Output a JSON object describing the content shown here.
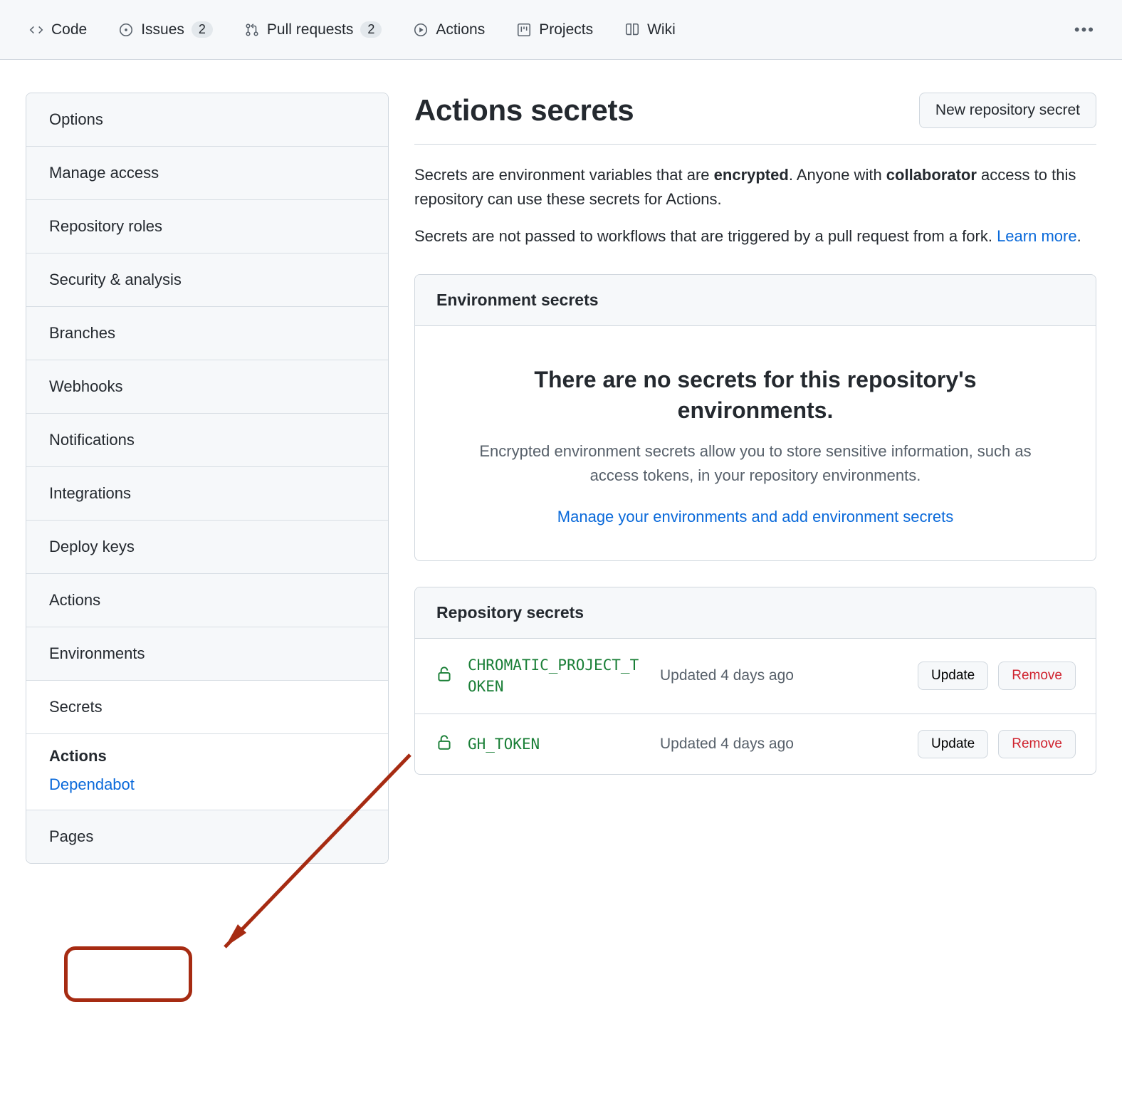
{
  "topnav": {
    "tabs": [
      {
        "label": "Code"
      },
      {
        "label": "Issues",
        "count": "2"
      },
      {
        "label": "Pull requests",
        "count": "2"
      },
      {
        "label": "Actions"
      },
      {
        "label": "Projects"
      },
      {
        "label": "Wiki"
      }
    ]
  },
  "sidebar": {
    "items": [
      "Options",
      "Manage access",
      "Repository roles",
      "Security & analysis",
      "Branches",
      "Webhooks",
      "Notifications",
      "Integrations",
      "Deploy keys",
      "Actions",
      "Environments",
      "Secrets"
    ],
    "sub": {
      "heading": "Actions",
      "link": "Dependabot"
    },
    "pages": "Pages"
  },
  "header": {
    "title": "Actions secrets",
    "new_button": "New repository secret"
  },
  "description": {
    "p1_a": "Secrets are environment variables that are ",
    "p1_b": "encrypted",
    "p1_c": ". Anyone with ",
    "p1_d": "collaborator",
    "p1_e": " access to this repository can use these secrets for Actions.",
    "p2_a": "Secrets are not passed to workflows that are triggered by a pull request from a fork. ",
    "p2_link": "Learn more",
    "p2_b": "."
  },
  "env_panel": {
    "heading": "Environment secrets",
    "blank_title": "There are no secrets for this repository's environments.",
    "blank_desc": "Encrypted environment secrets allow you to store sensitive information, such as access tokens, in your repository environments.",
    "blank_link": "Manage your environments and add environment secrets"
  },
  "repo_panel": {
    "heading": "Repository secrets",
    "secrets": [
      {
        "name": "CHROMATIC_PROJECT_TOKEN",
        "updated": "Updated 4 days ago"
      },
      {
        "name": "GH_TOKEN",
        "updated": "Updated 4 days ago"
      }
    ],
    "update_label": "Update",
    "remove_label": "Remove"
  }
}
